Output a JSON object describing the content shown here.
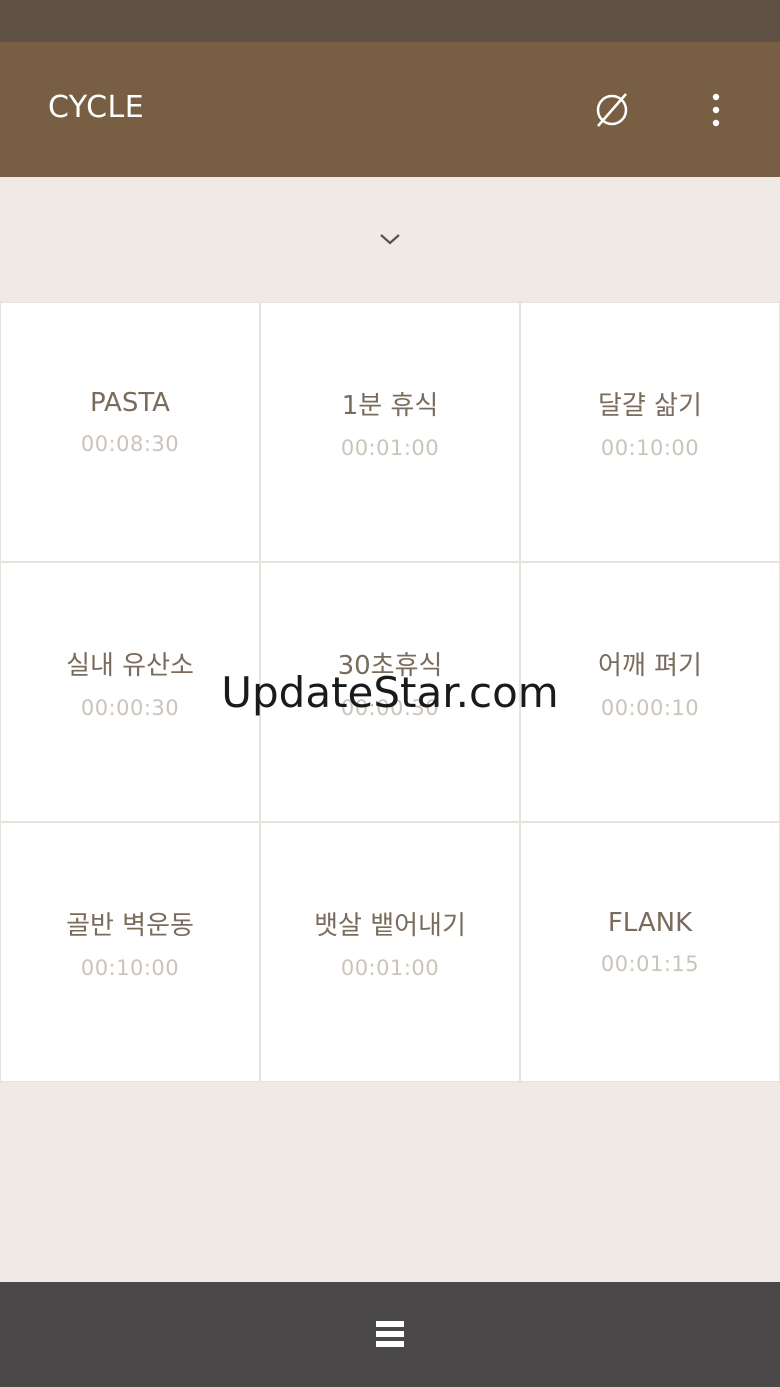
{
  "app_bar": {
    "title": "CYCLE",
    "empty_icon": "empty-set-icon",
    "more_icon": "more-vert-icon",
    "background": "#785f43"
  },
  "collapse": {
    "icon": "chevron-down-icon"
  },
  "timers": [
    {
      "name": "PASTA",
      "time": "00:08:30"
    },
    {
      "name": "1분 휴식",
      "time": "00:01:00"
    },
    {
      "name": "달걀 삶기",
      "time": "00:10:00"
    },
    {
      "name": "실내 유산소",
      "time": "00:00:30"
    },
    {
      "name": "30초휴식",
      "time": "00:00:30"
    },
    {
      "name": "어깨 펴기",
      "time": "00:00:10"
    },
    {
      "name": "골반 벽운동",
      "time": "00:10:00"
    },
    {
      "name": "뱃살 뱉어내기",
      "time": "00:01:00"
    },
    {
      "name": "FLANK",
      "time": "00:01:15"
    }
  ],
  "watermark": "UpdateStar.com",
  "bottom_bar": {
    "icon": "list-view-icon",
    "background": "#4a4848"
  }
}
